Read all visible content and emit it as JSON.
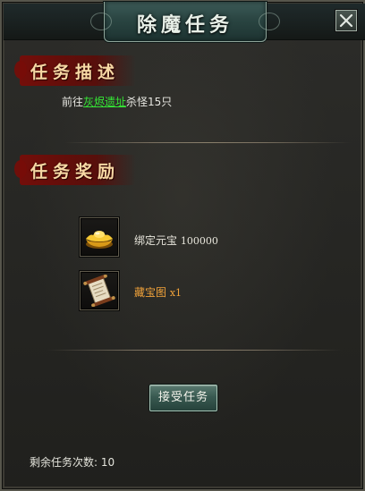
{
  "window": {
    "title": "除魔任务"
  },
  "icons": {
    "close": "close-icon",
    "gold_ingot": "gold-ingot-icon",
    "treasure_map": "scroll-map-icon"
  },
  "description": {
    "heading": "任务描述",
    "prefix": "前往",
    "location": "灰烬遗址",
    "suffix": "杀怪15只"
  },
  "rewards": {
    "heading": "任务奖励",
    "items": [
      {
        "name": "绑定元宝",
        "quantity": "100000"
      },
      {
        "name": "藏宝图",
        "quantity": "x1"
      }
    ]
  },
  "actions": {
    "accept_label": "接受任务"
  },
  "footer": {
    "remaining_label": "剩余任务次数:",
    "remaining_value": "10"
  },
  "colors": {
    "location_link": "#35e635",
    "rare_item": "#f0a23a",
    "banner_red": "#780c08"
  }
}
